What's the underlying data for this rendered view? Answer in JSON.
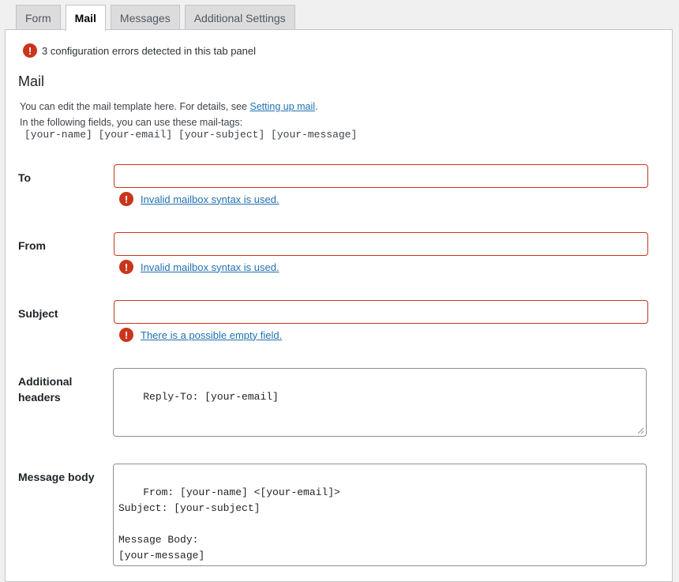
{
  "tabs": [
    {
      "label": "Form",
      "active": false
    },
    {
      "label": "Mail",
      "active": true
    },
    {
      "label": "Messages",
      "active": false
    },
    {
      "label": "Additional Settings",
      "active": false
    }
  ],
  "summary": {
    "text": "3 configuration errors detected in this tab panel",
    "icon": "error-icon"
  },
  "section": {
    "title": "Mail",
    "desc_prefix": "You can edit the mail template here. For details, see ",
    "desc_link": "Setting up mail",
    "desc_suffix": ".",
    "desc_line2": "In the following fields, you can use these mail-tags:",
    "mail_tags": "[your-name] [your-email] [your-subject] [your-message]"
  },
  "fields": {
    "to": {
      "label": "To",
      "value": "",
      "error": "Invalid mailbox syntax is used."
    },
    "from": {
      "label": "From",
      "value": "",
      "error": "Invalid mailbox syntax is used."
    },
    "subject": {
      "label": "Subject",
      "value": "",
      "error": "There is a possible empty field."
    },
    "additional_headers": {
      "label_line1": "Additional",
      "label_line2": "headers",
      "value": "Reply-To: [your-email]"
    },
    "message_body": {
      "label": "Message body",
      "value": "From: [your-name] <[your-email]>\nSubject: [your-subject]\n\nMessage Body:\n[your-message]"
    }
  },
  "colors": {
    "error": "#c9361c",
    "link": "#2271b1",
    "panel_bg": "#ffffff",
    "page_bg": "#f0f0f1"
  }
}
